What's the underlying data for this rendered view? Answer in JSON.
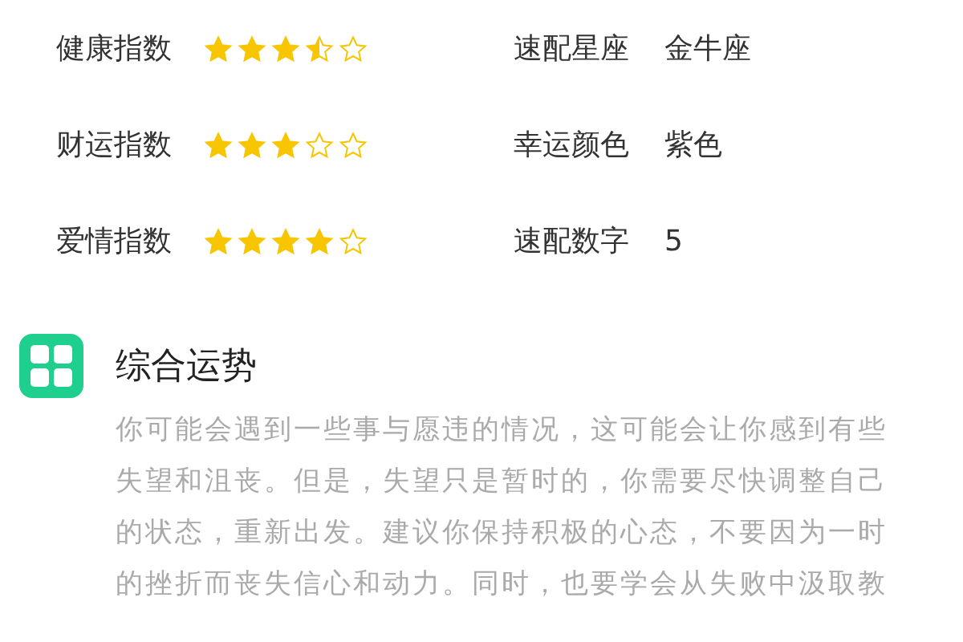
{
  "indices": [
    {
      "label": "健康指数",
      "stars": 3.5,
      "match_label": "速配星座",
      "match_value": "金牛座"
    },
    {
      "label": "财运指数",
      "stars": 3,
      "match_label": "幸运颜色",
      "match_value": "紫色"
    },
    {
      "label": "爱情指数",
      "stars": 4,
      "match_label": "速配数字",
      "match_value": "5"
    }
  ],
  "section": {
    "title": "综合运势",
    "text": "你可能会遇到一些事与愿违的情况，这可能会让你感到有些失望和沮丧。但是，失望只是暂时的，你需要尽快调整自己的状态，重新出发。建议你保持积极的心态，不要因为一时的挫折而丧失信心和动力。同时，也要学会从失败中汲取教"
  }
}
